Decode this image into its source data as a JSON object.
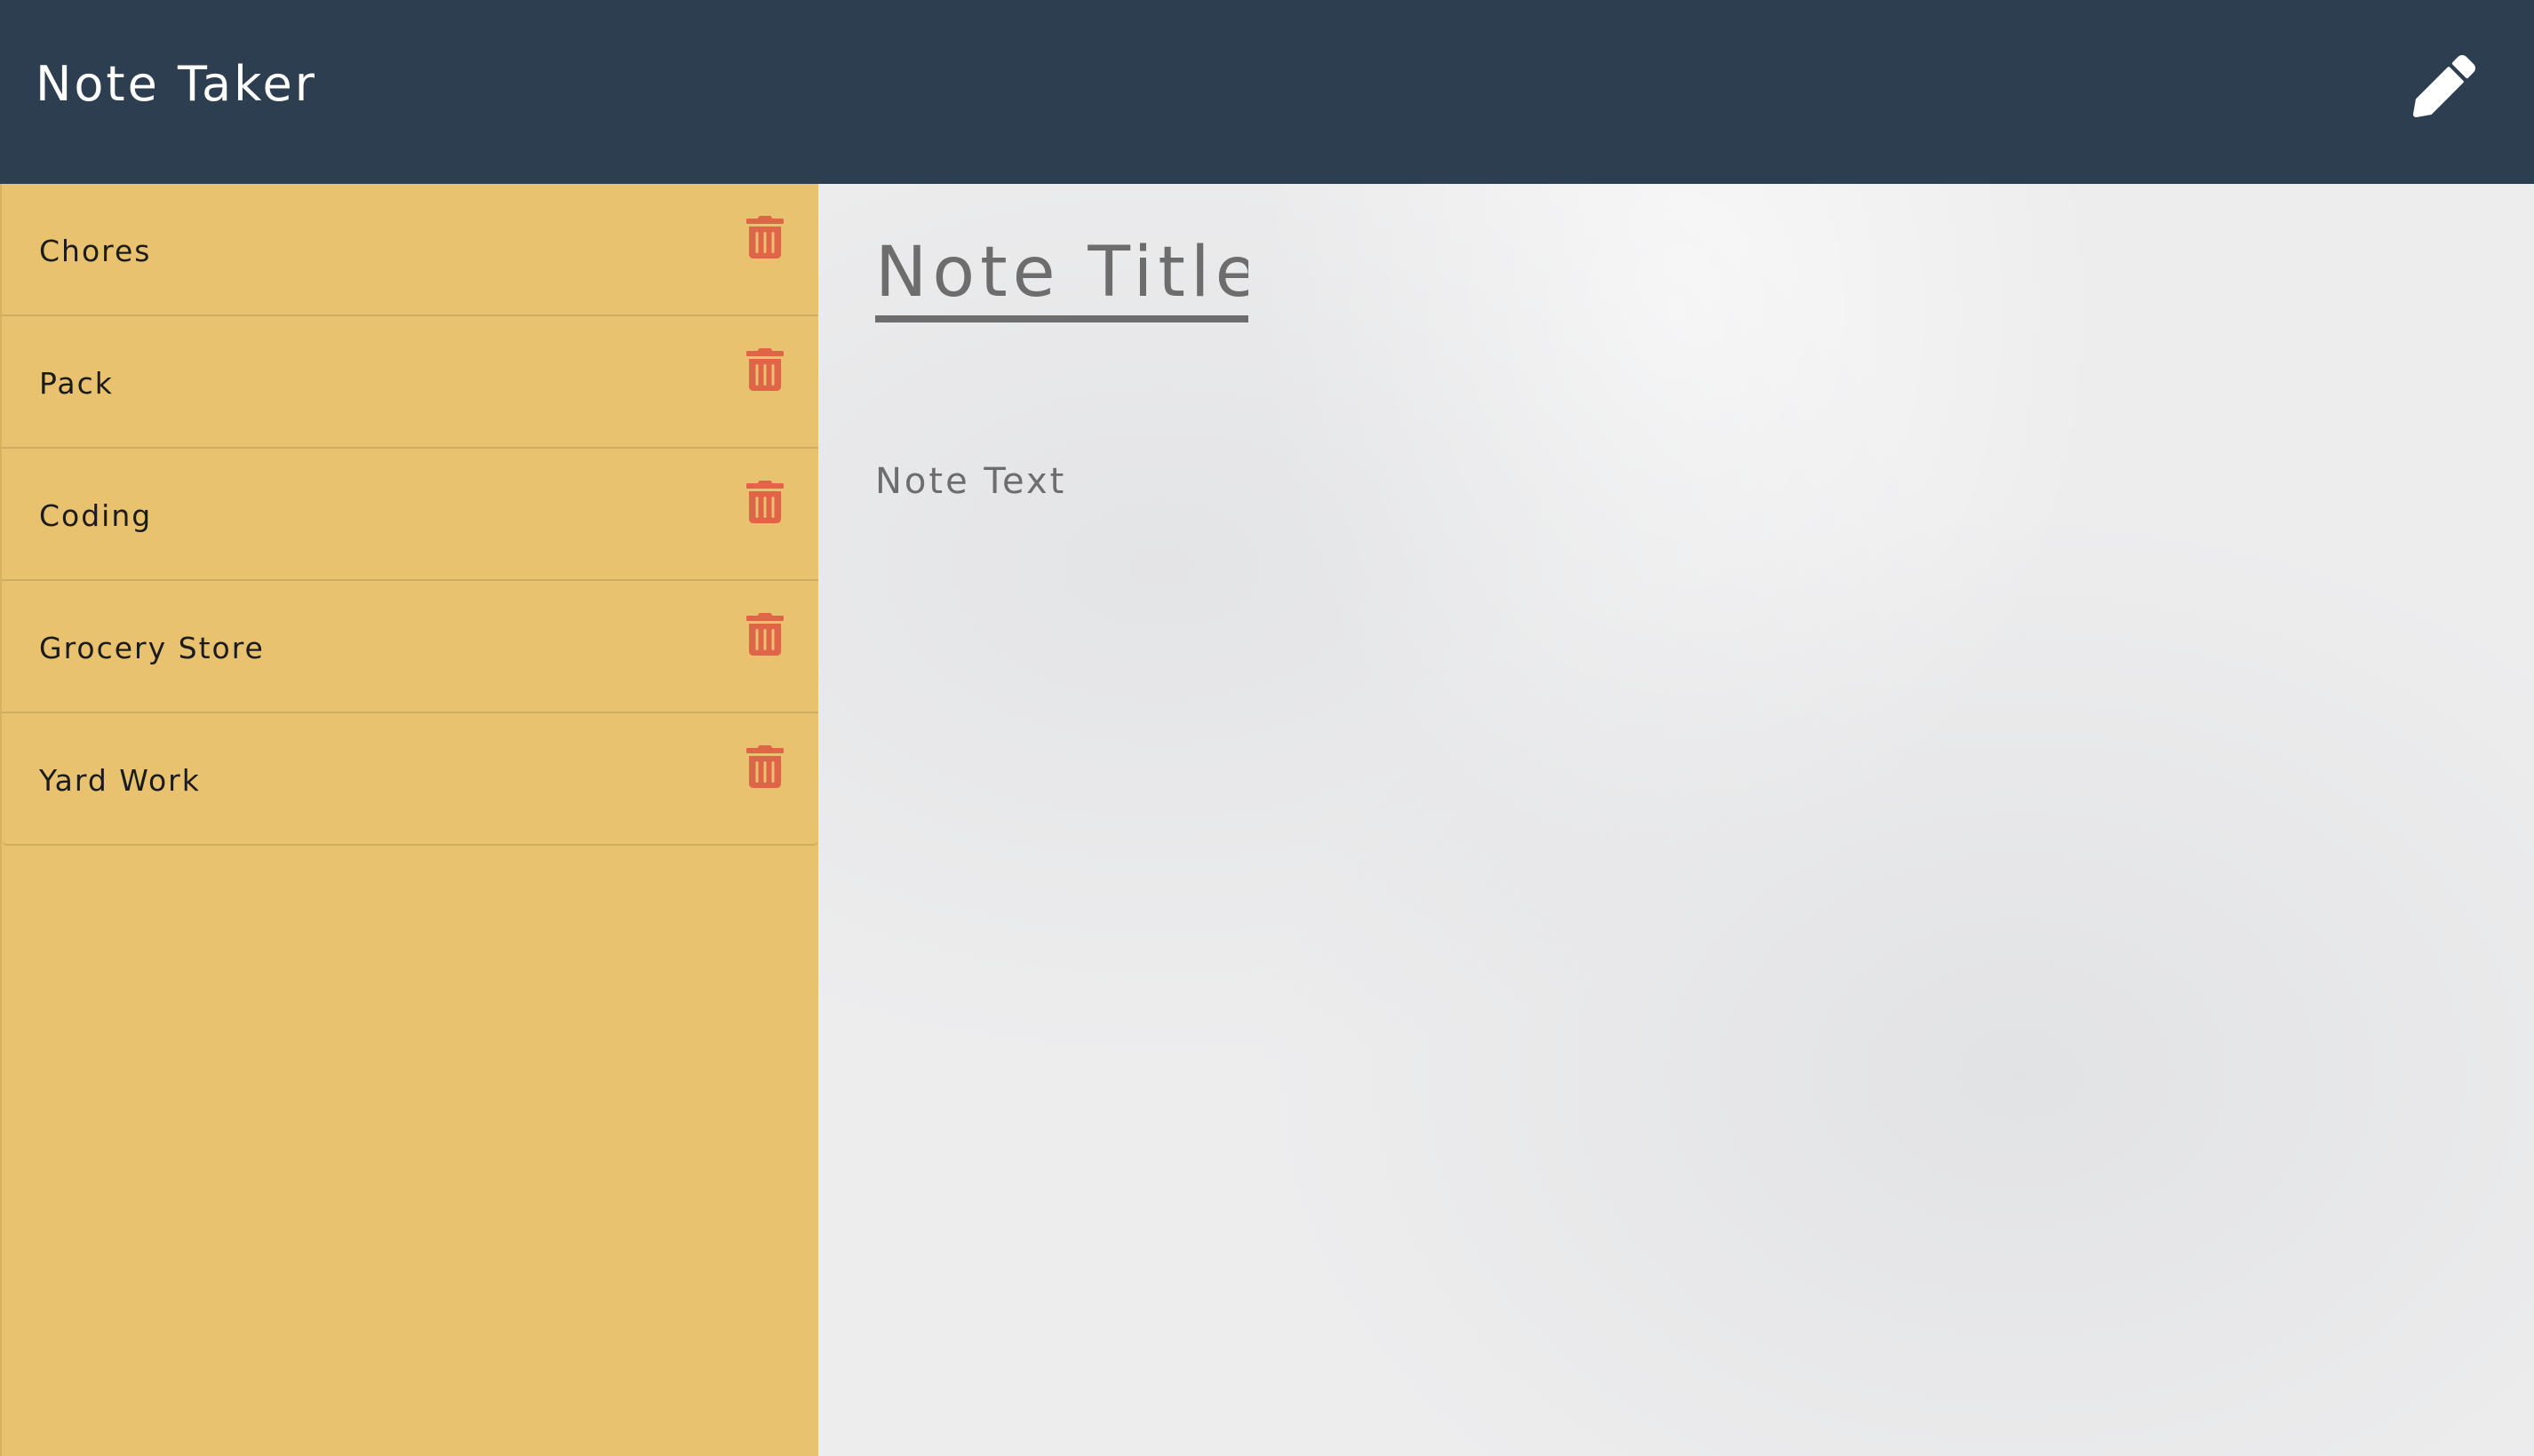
{
  "navbar": {
    "brand": "Note Taker",
    "new_note_icon": "pencil-icon",
    "icon_color": "#ffffff",
    "background": "#2c3e50"
  },
  "sidebar": {
    "background": "#e8c26e",
    "delete_icon": "trash-icon",
    "delete_icon_color": "#e06448",
    "notes": [
      {
        "label": "Chores"
      },
      {
        "label": "Pack"
      },
      {
        "label": "Coding"
      },
      {
        "label": "Grocery Store"
      },
      {
        "label": "Yard Work"
      }
    ]
  },
  "editor": {
    "title_placeholder": "Note Title",
    "text_placeholder": "Note Text",
    "title_value": "",
    "text_value": ""
  }
}
